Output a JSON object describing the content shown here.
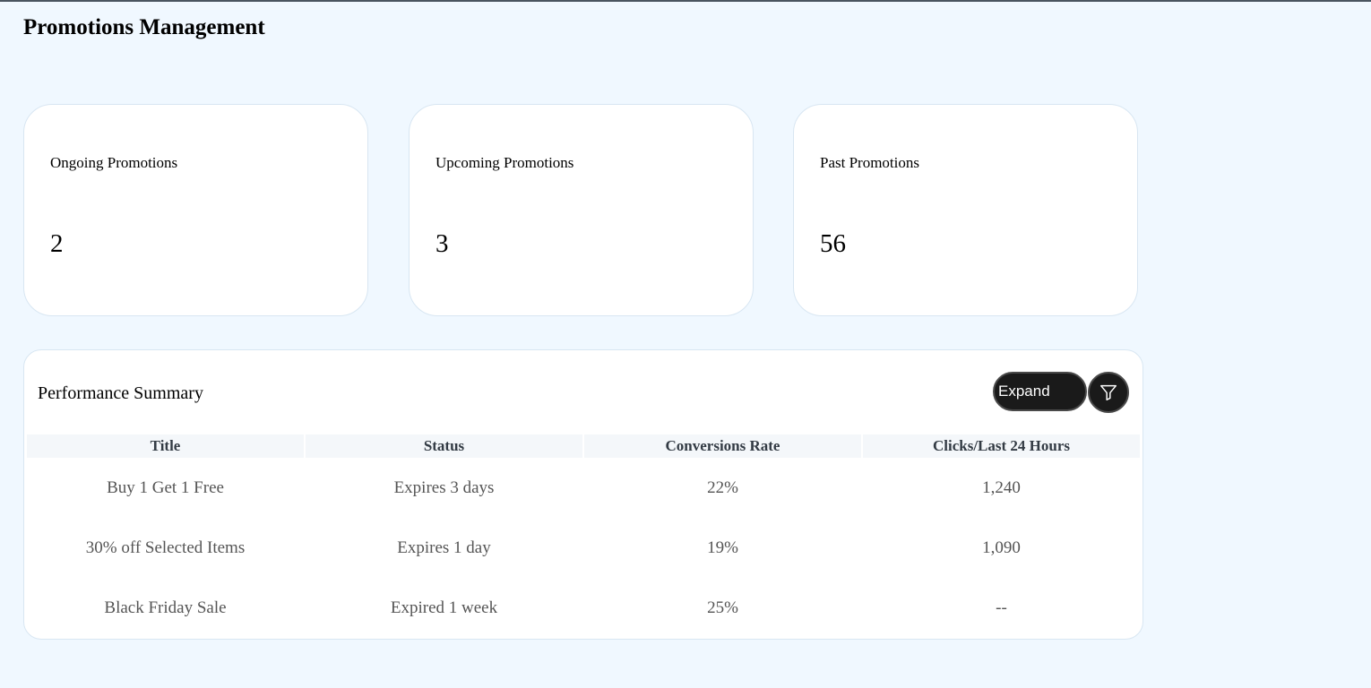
{
  "page": {
    "title": "Promotions Management"
  },
  "stats": [
    {
      "label": "Ongoing Promotions",
      "value": "2"
    },
    {
      "label": "Upcoming Promotions",
      "value": "3"
    },
    {
      "label": "Past Promotions",
      "value": "56"
    }
  ],
  "performance": {
    "title": "Performance Summary",
    "expand_label": "Expand",
    "filter_icon": "funnel-filter-icon",
    "columns": [
      "Title",
      "Status",
      "Conversions Rate",
      "Clicks/Last 24 Hours"
    ],
    "rows": [
      [
        "Buy 1 Get 1 Free",
        "Expires 3 days",
        "22%",
        "1,240"
      ],
      [
        "30% off Selected Items",
        "Expires 1 day",
        "19%",
        "1,090"
      ],
      [
        "Black Friday Sale",
        "Expired 1 week",
        "25%",
        "--"
      ]
    ]
  },
  "colors": {
    "background": "#f0f8ff",
    "card": "#ffffff",
    "button": "#1a1a1a",
    "header_row": "#f4f7fa"
  }
}
